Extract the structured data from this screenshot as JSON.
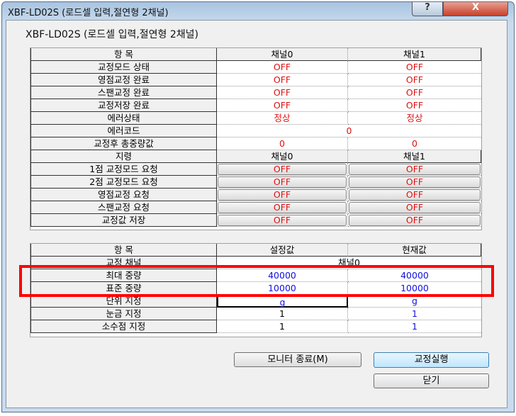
{
  "window": {
    "title": "XBF-LD02S (로드셀 입력,절연형 2채널)",
    "help": "?",
    "close": "X"
  },
  "subtitle": "XBF-LD02S (로드셀 입력,절연형 2채널)",
  "monitor": {
    "header": [
      "항 목",
      "채널0",
      "채널1"
    ],
    "rows": [
      {
        "label": "교정모드 상태",
        "ch0": "OFF",
        "ch1": "OFF"
      },
      {
        "label": "영점교정 완료",
        "ch0": "OFF",
        "ch1": "OFF"
      },
      {
        "label": "스팬교정 완료",
        "ch0": "OFF",
        "ch1": "OFF"
      },
      {
        "label": "교정저장 완료",
        "ch0": "OFF",
        "ch1": "OFF"
      },
      {
        "label": "에러상태",
        "ch0": "정상",
        "ch1": "정상"
      },
      {
        "label": "에러코드",
        "value": "0"
      },
      {
        "label": "교정후 총중량값",
        "ch0": "0",
        "ch1": "0"
      }
    ],
    "command_header": [
      "지령",
      "채널0",
      "채널1"
    ],
    "commands": [
      {
        "label": "1점 교정모드 요청",
        "ch0": "OFF",
        "ch1": "OFF"
      },
      {
        "label": "2점 교정모드 요청",
        "ch0": "OFF",
        "ch1": "OFF"
      },
      {
        "label": "영점교정 요청",
        "ch0": "OFF",
        "ch1": "OFF"
      },
      {
        "label": "스팬교정 요청",
        "ch0": "OFF",
        "ch1": "OFF"
      },
      {
        "label": "교정값 저장",
        "ch0": "OFF",
        "ch1": "OFF"
      }
    ]
  },
  "settings": {
    "header": [
      "항 목",
      "설정값",
      "현재값"
    ],
    "channel": {
      "label": "교정 채널",
      "value": "채널0"
    },
    "rows": [
      {
        "label": "최대 중량",
        "set": "40000",
        "cur": "40000"
      },
      {
        "label": "표준 중량",
        "set": "10000",
        "cur": "10000"
      },
      {
        "label": "단위 지정",
        "set": "g",
        "cur": "g"
      },
      {
        "label": "눈금 지정",
        "set": "1",
        "cur": "1"
      },
      {
        "label": "소수점 지정",
        "set": "1",
        "cur": "1"
      }
    ]
  },
  "buttons": {
    "monitor_end": "모니터 종료(M)",
    "run_calibration": "교정실행",
    "close": "닫기"
  },
  "colors": {
    "status": "#e01010",
    "value": "#1010e0",
    "highlight": "#ff0000"
  }
}
